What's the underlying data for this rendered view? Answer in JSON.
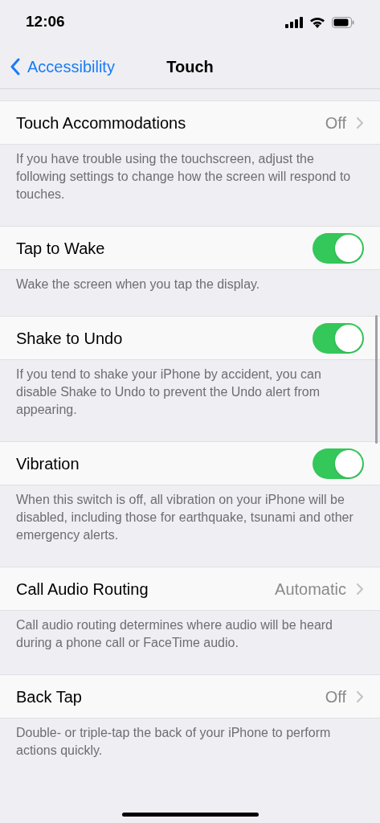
{
  "status_bar": {
    "time": "12:06"
  },
  "nav": {
    "back_label": "Accessibility",
    "title": "Touch"
  },
  "sections": [
    {
      "row": {
        "kind": "value",
        "label": "Touch Accommodations",
        "value": "Off"
      },
      "footer": "If you have trouble using the touchscreen, adjust the following settings to change how the screen will respond to touches."
    },
    {
      "row": {
        "kind": "switch",
        "label": "Tap to Wake",
        "on": true
      },
      "footer": "Wake the screen when you tap the display."
    },
    {
      "row": {
        "kind": "switch",
        "label": "Shake to Undo",
        "on": true
      },
      "footer": "If you tend to shake your iPhone by accident, you can disable Shake to Undo to prevent the Undo alert from appearing."
    },
    {
      "row": {
        "kind": "switch",
        "label": "Vibration",
        "on": true
      },
      "footer": "When this switch is off, all vibration on your iPhone will be disabled, including those for earthquake, tsunami and other emergency alerts."
    },
    {
      "row": {
        "kind": "value",
        "label": "Call Audio Routing",
        "value": "Automatic"
      },
      "footer": "Call audio routing determines where audio will be heard during a phone call or FaceTime audio."
    },
    {
      "row": {
        "kind": "value",
        "label": "Back Tap",
        "value": "Off"
      },
      "footer": "Double- or triple-tap the back of your iPhone to perform actions quickly."
    }
  ]
}
